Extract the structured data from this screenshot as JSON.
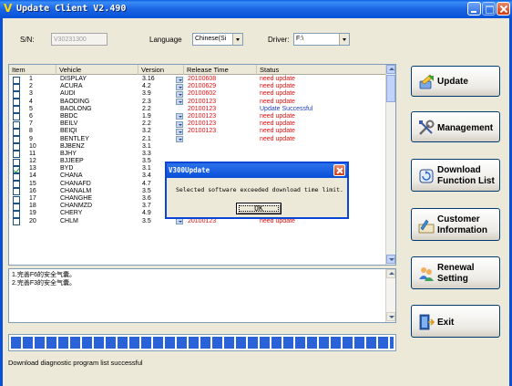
{
  "window": {
    "title": "Update Client V2.490",
    "app_icon": "V"
  },
  "form": {
    "sn_label": "S/N:",
    "sn_value": "V30231300",
    "language_label": "Language",
    "language_value": "Chinese(Si",
    "driver_label": "Driver:",
    "driver_value": "F:\\"
  },
  "table": {
    "columns": [
      "Item",
      "Vehicle",
      "Version",
      "Release Time",
      "Status"
    ],
    "rows": [
      {
        "checked": false,
        "item": "1",
        "vehicle": "DISPLAY",
        "version": "3.16",
        "date": "20100608",
        "status": "need update",
        "status_color": "red",
        "has_dropdown": true
      },
      {
        "checked": false,
        "item": "2",
        "vehicle": "ACURA",
        "version": "4.2",
        "date": "20100629",
        "status": "need update",
        "status_color": "red",
        "has_dropdown": true
      },
      {
        "checked": false,
        "item": "3",
        "vehicle": "AUDI",
        "version": "3.9",
        "date": "20100602",
        "status": "need update",
        "status_color": "red",
        "has_dropdown": true
      },
      {
        "checked": false,
        "item": "4",
        "vehicle": "BAODING",
        "version": "2.3",
        "date": "20100123",
        "status": "need update",
        "status_color": "red",
        "has_dropdown": true
      },
      {
        "checked": false,
        "item": "5",
        "vehicle": "BAOLONG",
        "version": "2.2",
        "date": "20100123",
        "status": "Update Successful",
        "status_color": "blue",
        "has_dropdown": false
      },
      {
        "checked": false,
        "item": "6",
        "vehicle": "BBDC",
        "version": "1.9",
        "date": "20100123",
        "status": "need update",
        "status_color": "red",
        "has_dropdown": true
      },
      {
        "checked": false,
        "item": "7",
        "vehicle": "BEILV",
        "version": "2.2",
        "date": "20100123",
        "status": "need update",
        "status_color": "red",
        "has_dropdown": true
      },
      {
        "checked": false,
        "item": "8",
        "vehicle": "BEIQI",
        "version": "3.2",
        "date": "20100123",
        "status": "need update",
        "status_color": "red",
        "has_dropdown": true
      },
      {
        "checked": false,
        "item": "9",
        "vehicle": "BENTLEY",
        "version": "2.1",
        "date": "",
        "status": "need update",
        "status_color": "red",
        "has_dropdown": true
      },
      {
        "checked": false,
        "item": "10",
        "vehicle": "BJBENZ",
        "version": "3.1",
        "date": "",
        "status": "",
        "status_color": "red",
        "has_dropdown": false
      },
      {
        "checked": false,
        "item": "11",
        "vehicle": "BJHY",
        "version": "3.3",
        "date": "",
        "status": "",
        "status_color": "red",
        "has_dropdown": false
      },
      {
        "checked": false,
        "item": "12",
        "vehicle": "BJJEEP",
        "version": "3.5",
        "date": "",
        "status": "",
        "status_color": "red",
        "has_dropdown": false
      },
      {
        "checked": true,
        "item": "13",
        "vehicle": "BYD",
        "version": "3.1",
        "date": "",
        "status": "",
        "status_color": "red",
        "has_dropdown": false
      },
      {
        "checked": false,
        "item": "14",
        "vehicle": "CHANA",
        "version": "3.4",
        "date": "",
        "status": "",
        "status_color": "red",
        "has_dropdown": false
      },
      {
        "checked": false,
        "item": "15",
        "vehicle": "CHANAFD",
        "version": "4.7",
        "date": "",
        "status": "",
        "status_color": "red",
        "has_dropdown": false
      },
      {
        "checked": false,
        "item": "16",
        "vehicle": "CHANALM",
        "version": "3.5",
        "date": "20100123",
        "status": "need update",
        "status_color": "red",
        "has_dropdown": true
      },
      {
        "checked": false,
        "item": "17",
        "vehicle": "CHANGHE",
        "version": "3.6",
        "date": "20100428",
        "status": "need update",
        "status_color": "red",
        "has_dropdown": true
      },
      {
        "checked": false,
        "item": "18",
        "vehicle": "CHANMZD",
        "version": "3.7",
        "date": "20100531",
        "status": "need update",
        "status_color": "red",
        "has_dropdown": true
      },
      {
        "checked": false,
        "item": "19",
        "vehicle": "CHERY",
        "version": "4.9",
        "date": "20100209",
        "status": "need update",
        "status_color": "red",
        "has_dropdown": true
      },
      {
        "checked": false,
        "item": "20",
        "vehicle": "CHLM",
        "version": "3.5",
        "date": "20100123",
        "status": "need update",
        "status_color": "red",
        "has_dropdown": true
      }
    ]
  },
  "info": {
    "lines": [
      "1.完善F6的安全气囊。",
      "2.完善F3的安全气囊。"
    ]
  },
  "progress": {
    "percent": 100
  },
  "status_bar": {
    "text": "Download diagnostic program list successful"
  },
  "buttons": {
    "update": "Update",
    "management": "Management",
    "download_line1": "Download",
    "download_line2": "Function List",
    "customer_line1": "Customer",
    "customer_line2": "Information",
    "renewal_line1": "Renewal",
    "renewal_line2": "Setting",
    "exit": "Exit"
  },
  "dialog": {
    "title": "V300Update",
    "message": "Selected software exceeded download time limit.",
    "ok": "OK"
  },
  "icons": {
    "app": "v-logo-icon",
    "update": "update-arrow-icon",
    "management": "tools-icon",
    "download": "download-list-icon",
    "customer": "customer-info-icon",
    "renewal": "users-icon",
    "exit": "exit-door-icon"
  }
}
